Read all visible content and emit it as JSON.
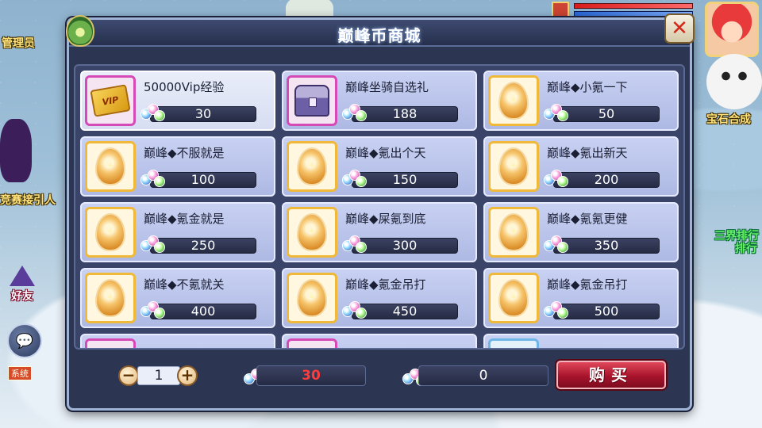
{
  "scene": {
    "labels": {
      "admin": "管理员",
      "competition_guide": "竞赛接引人",
      "gem_synthesis": "宝石合成",
      "ranking_line1": "三界排行",
      "ranking_line2": "排行"
    },
    "friend_button": "好友",
    "system_badge": "系统"
  },
  "dialog": {
    "title": "巅峰币商城",
    "items": [
      {
        "name": "50000Vip经验",
        "price": "30",
        "icon": "vip-card-icon"
      },
      {
        "name": "巅峰坐骑自选礼",
        "price": "188",
        "icon": "treasure-chest-icon"
      },
      {
        "name": "巅峰◆小氪一下",
        "price": "50",
        "icon": "golden-egg-icon"
      },
      {
        "name": "巅峰◆不服就是",
        "price": "100",
        "icon": "golden-egg-icon"
      },
      {
        "name": "巅峰◆氪出个天",
        "price": "150",
        "icon": "golden-egg-icon"
      },
      {
        "name": "巅峰◆氪出新天",
        "price": "200",
        "icon": "golden-egg-icon"
      },
      {
        "name": "巅峰◆氪金就是",
        "price": "250",
        "icon": "golden-egg-icon"
      },
      {
        "name": "巅峰◆屎氪到底",
        "price": "300",
        "icon": "golden-egg-icon"
      },
      {
        "name": "巅峰◆氪氪更健",
        "price": "350",
        "icon": "golden-egg-icon"
      },
      {
        "name": "巅峰◆不氪就关",
        "price": "400",
        "icon": "golden-egg-icon"
      },
      {
        "name": "巅峰◆氪金吊打",
        "price": "450",
        "icon": "golden-egg-icon"
      },
      {
        "name": "巅峰◆氪金吊打",
        "price": "500",
        "icon": "golden-egg-icon"
      }
    ],
    "selected_index": 0,
    "quantity": "1",
    "total_cost": "30",
    "balance": "0",
    "buy_label": "购买",
    "qty_minus": "−",
    "qty_plus": "+",
    "colors": {
      "cost": "#ff3b3b",
      "buy_button": "#a8142c"
    }
  }
}
